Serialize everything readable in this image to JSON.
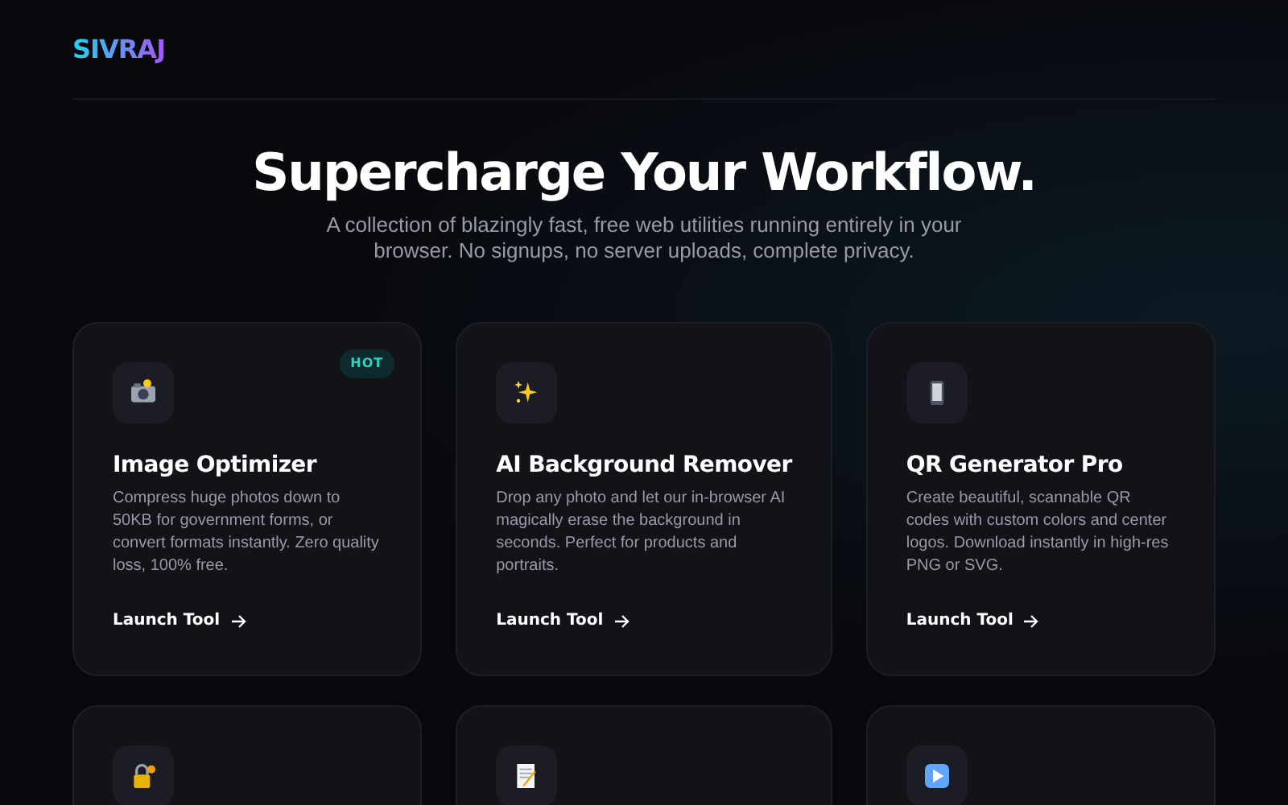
{
  "brand": "SIVRAJ",
  "hero": {
    "title": "Supercharge Your Workflow.",
    "subtitle": "A collection of blazingly fast, free web utilities running entirely in your browser. No signups, no server uploads, complete privacy."
  },
  "cards": [
    {
      "kind": "tool",
      "title": "Image Optimizer",
      "badge": "HOT",
      "description": "Compress huge photos down to 50KB for government forms, or convert formats instantly. Zero quality loss, 100% free.",
      "link": "Launch Tool"
    },
    {
      "kind": "tool",
      "title": "AI Background Remover",
      "description": "Drop any photo and let our in-browser AI magically erase the background in seconds. Perfect for products and portraits.",
      "link": "Launch Tool"
    },
    {
      "kind": "tool",
      "title": "QR Generator Pro",
      "description": "Create beautiful, scannable QR codes with custom colors and center logos. Download instantly in high-res PNG or SVG.",
      "link": "Launch Tool"
    },
    {
      "kind": "tool"
    },
    {
      "kind": "tool"
    },
    {
      "kind": "tool"
    }
  ]
}
